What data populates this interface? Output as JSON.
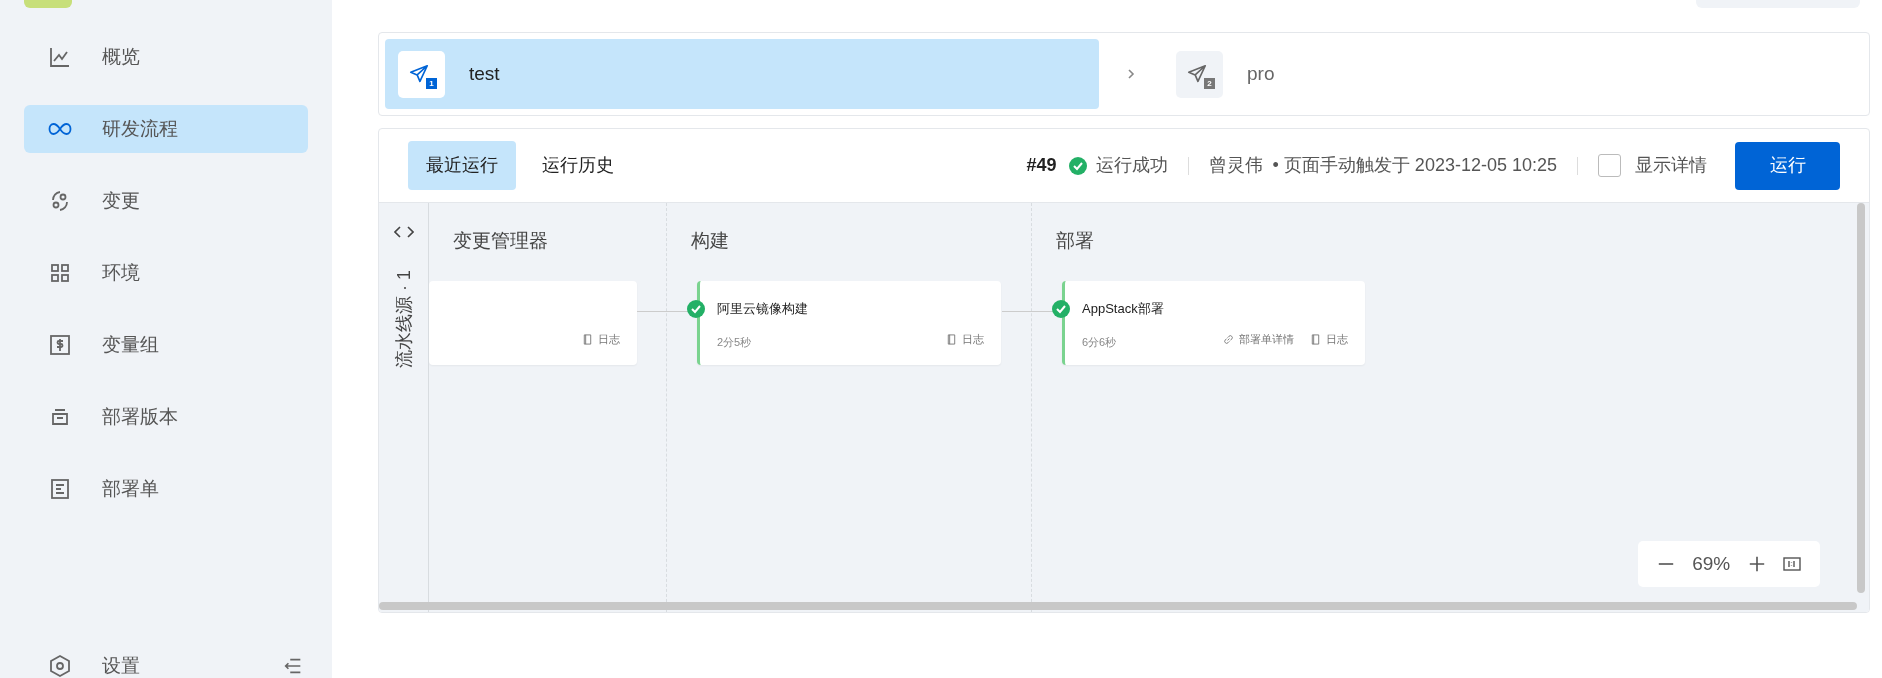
{
  "sidebar": {
    "items": [
      {
        "label": "概览",
        "selected": false
      },
      {
        "label": "研发流程",
        "selected": true
      },
      {
        "label": "变更",
        "selected": false
      },
      {
        "label": "环境",
        "selected": false
      },
      {
        "label": "变量组",
        "selected": false
      },
      {
        "label": "部署版本",
        "selected": false
      },
      {
        "label": "部署单",
        "selected": false
      }
    ],
    "footer": {
      "label": "设置"
    }
  },
  "stages": [
    {
      "label": "test",
      "number": "1",
      "selected": true
    },
    {
      "label": "pro",
      "number": "2",
      "selected": false
    }
  ],
  "run": {
    "tabs": [
      {
        "label": "最近运行",
        "selected": true
      },
      {
        "label": "运行历史",
        "selected": false
      }
    ],
    "number": "#49",
    "status": "运行成功",
    "user": "曾灵伟",
    "trigger": "• 页面手动触发于 2023-12-05 10:25",
    "details": {
      "label": "显示详情",
      "checked": false
    },
    "run_button": "运行"
  },
  "pipeline": {
    "source": "流水线源 · 1",
    "columns": [
      {
        "title": "变更管理器",
        "jobs": [
          {
            "actions": [
              {
                "kind": "log",
                "label": "日志"
              }
            ]
          }
        ]
      },
      {
        "title": "构建",
        "jobs": [
          {
            "name": "阿里云镜像构建",
            "succeeded": true,
            "duration": "2分5秒",
            "actions": [
              {
                "kind": "log",
                "label": "日志"
              }
            ]
          }
        ]
      },
      {
        "title": "部署",
        "jobs": [
          {
            "name": "AppStack部署",
            "succeeded": true,
            "duration": "6分6秒",
            "actions": [
              {
                "kind": "link",
                "label": "部署单详情"
              },
              {
                "kind": "log",
                "label": "日志"
              }
            ]
          }
        ]
      }
    ],
    "zoom": "69%"
  }
}
